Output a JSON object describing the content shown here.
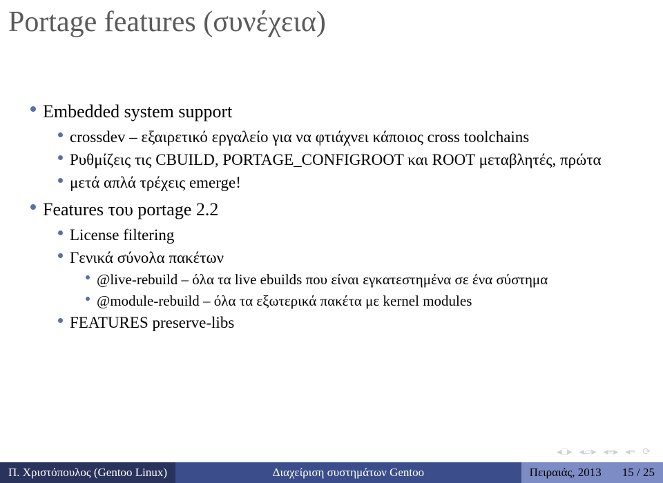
{
  "title": "Portage features (συνέχεια)",
  "bullets": {
    "l1a": "Embedded system support",
    "l2a": "crossdev – εξαιρετικό εργαλείο για να φτιάχνει κάποιος cross toolchains",
    "l2b": "Ρυθμίζεις τις CBUILD, PORTAGE_CONFIGROOT και ROOT μεταβλητές, πρώτα",
    "l2c": "μετά απλά τρέχεις emerge!",
    "l1b": "Features του portage 2.2",
    "l2d": "License filtering",
    "l2e": "Γενικά σύνολα πακέτων",
    "l3a": "@live-rebuild – όλα τα live ebuilds που είναι εγκατεστημένα σε ένα σύστημα",
    "l3b": "@module-rebuild – όλα τα εξωτερικά πακέτα με kernel modules",
    "l2f": "FEATURES preserve-libs"
  },
  "footer": {
    "author": "Π. Χριστόπουλος (Gentoo Linux)",
    "title": "Διαχείριση συστημάτων Gentoo",
    "date": "Πειραιάς, 2013",
    "page": "15 / 25"
  }
}
